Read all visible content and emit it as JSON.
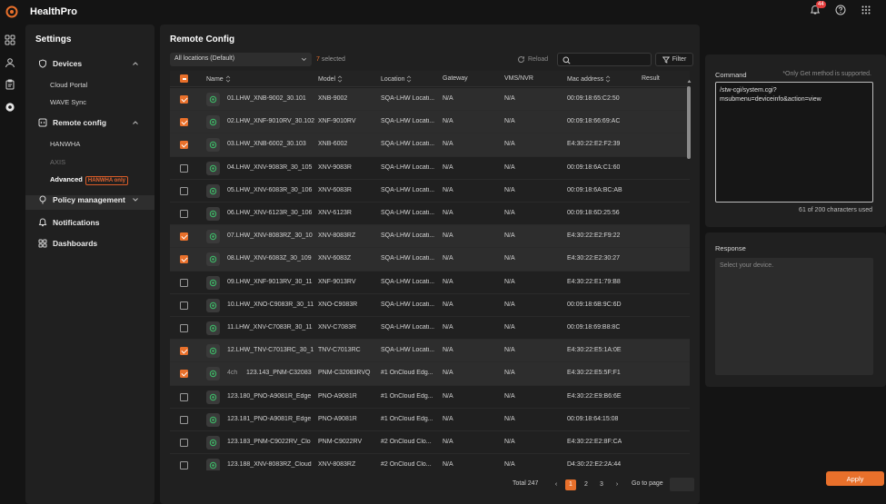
{
  "app": {
    "title": "HealthPro",
    "notification_count": "44"
  },
  "settings": {
    "title": "Settings",
    "groups": {
      "devices": "Devices",
      "remote_config": "Remote config",
      "policy": "Policy management",
      "notifications": "Notifications",
      "dashboards": "Dashboards"
    },
    "devices_items": [
      "Cloud Portal",
      "WAVE Sync"
    ],
    "remote_items": [
      "HANWHA",
      "AXIS",
      "Advanced"
    ],
    "hanwha_only": "HANWHA only"
  },
  "main": {
    "title": "Remote Config",
    "location_filter": "All locations (Default)",
    "selected_num": "7",
    "selected_label": "selected",
    "reload": "Reload",
    "filter": "Filter",
    "columns": [
      "Name",
      "Model",
      "Location",
      "Gateway",
      "VMS/NVR",
      "Mac address",
      "Result"
    ],
    "rows": [
      {
        "checked": true,
        "prefix": "",
        "name": "01.LHW_XNB-9002_30.101",
        "model": "XNB-9002",
        "location": "SQA-LHW Locati...",
        "gateway": "N/A",
        "vms": "N/A",
        "mac": "00:09:18:65:C2:50"
      },
      {
        "checked": true,
        "prefix": "",
        "name": "02.LHW_XNF-9010RV_30.102",
        "model": "XNF-9010RV",
        "location": "SQA-LHW Locati...",
        "gateway": "N/A",
        "vms": "N/A",
        "mac": "00:09:18:66:69:AC"
      },
      {
        "checked": true,
        "prefix": "",
        "name": "03.LHW_XNB-6002_30.103",
        "model": "XNB-6002",
        "location": "SQA-LHW Locati...",
        "gateway": "N/A",
        "vms": "N/A",
        "mac": "E4:30:22:E2:F2:39"
      },
      {
        "checked": false,
        "prefix": "",
        "name": "04.LHW_XNV-9083R_30_105",
        "model": "XNV-9083R",
        "location": "SQA-LHW Locati...",
        "gateway": "N/A",
        "vms": "N/A",
        "mac": "00:09:18:6A:C1:60"
      },
      {
        "checked": false,
        "prefix": "",
        "name": "05.LHW_XNV-6083R_30_106",
        "model": "XNV-6083R",
        "location": "SQA-LHW Locati...",
        "gateway": "N/A",
        "vms": "N/A",
        "mac": "00:09:18:6A:BC:AB"
      },
      {
        "checked": false,
        "prefix": "",
        "name": "06.LHW_XNV-6123R_30_106",
        "model": "XNV-6123R",
        "location": "SQA-LHW Locati...",
        "gateway": "N/A",
        "vms": "N/A",
        "mac": "00:09:18:6D:25:56"
      },
      {
        "checked": true,
        "prefix": "",
        "name": "07.LHW_XNV-8083RZ_30_10",
        "model": "XNV-8083RZ",
        "location": "SQA-LHW Locati...",
        "gateway": "N/A",
        "vms": "N/A",
        "mac": "E4:30:22:E2:F9:22"
      },
      {
        "checked": true,
        "prefix": "",
        "name": "08.LHW_XNV-6083Z_30_109",
        "model": "XNV-6083Z",
        "location": "SQA-LHW Locati...",
        "gateway": "N/A",
        "vms": "N/A",
        "mac": "E4:30:22:E2:30:27"
      },
      {
        "checked": false,
        "prefix": "",
        "name": "09.LHW_XNF-9013RV_30_11",
        "model": "XNF-9013RV",
        "location": "SQA-LHW Locati...",
        "gateway": "N/A",
        "vms": "N/A",
        "mac": "E4:30:22:E1:79:B8"
      },
      {
        "checked": false,
        "prefix": "",
        "name": "10.LHW_XNO-C9083R_30_11",
        "model": "XNO-C9083R",
        "location": "SQA-LHW Locati...",
        "gateway": "N/A",
        "vms": "N/A",
        "mac": "00:09:18:6B:9C:6D"
      },
      {
        "checked": false,
        "prefix": "",
        "name": "11.LHW_XNV-C7083R_30_11",
        "model": "XNV-C7083R",
        "location": "SQA-LHW Locati...",
        "gateway": "N/A",
        "vms": "N/A",
        "mac": "00:09:18:69:B8:8C"
      },
      {
        "checked": true,
        "prefix": "",
        "name": "12.LHW_TNV-C7013RC_30_1",
        "model": "TNV-C7013RC",
        "location": "SQA-LHW Locati...",
        "gateway": "N/A",
        "vms": "N/A",
        "mac": "E4:30:22:E5:1A:0E"
      },
      {
        "checked": true,
        "prefix": "4ch",
        "name": "123.143_PNM-C32083",
        "model": "PNM-C32083RVQ",
        "location": "#1 OnCloud Edg...",
        "gateway": "N/A",
        "vms": "N/A",
        "mac": "E4:30:22:E5:5F:F1"
      },
      {
        "checked": false,
        "prefix": "",
        "name": "123.180_PNO-A9081R_Edge",
        "model": "PNO-A9081R",
        "location": "#1 OnCloud Edg...",
        "gateway": "N/A",
        "vms": "N/A",
        "mac": "E4:30:22:E9:B6:6E"
      },
      {
        "checked": false,
        "prefix": "",
        "name": "123.181_PNO-A9081R_Edge",
        "model": "PNO-A9081R",
        "location": "#1 OnCloud Edg...",
        "gateway": "N/A",
        "vms": "N/A",
        "mac": "00:09:18:64:15:08"
      },
      {
        "checked": false,
        "prefix": "",
        "name": "123.183_PNM-C9022RV_Clo",
        "model": "PNM-C9022RV",
        "location": "#2 OnCloud Clo...",
        "gateway": "N/A",
        "vms": "N/A",
        "mac": "E4:30:22:E2:8F:CA"
      },
      {
        "checked": false,
        "prefix": "",
        "name": "123.188_XNV-8083RZ_Cloud",
        "model": "XNV-8083RZ",
        "location": "#2 OnCloud Clo...",
        "gateway": "N/A",
        "vms": "N/A",
        "mac": "D4:30:22:E2:2A:44"
      }
    ],
    "pagination": {
      "total": "Total 247",
      "pages": [
        "1",
        "2",
        "3"
      ],
      "prev": "‹",
      "next": "›",
      "goto_label": "Go to page"
    }
  },
  "command": {
    "label": "Command",
    "note": "*Only Get method is supported.",
    "value": "/stw-cgi/system.cgi?\nmsubmenu=deviceinfo&action=view",
    "char_count": "61 of 200 characters used"
  },
  "response": {
    "label": "Response",
    "placeholder": "Select your device."
  },
  "apply_label": "Apply",
  "colors": {
    "accent": "#e8702b",
    "background": "#141414",
    "panel": "#202020"
  }
}
